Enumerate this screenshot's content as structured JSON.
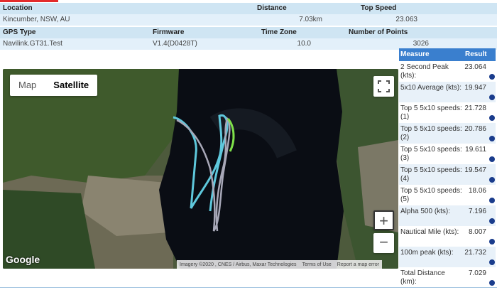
{
  "info": {
    "headers1": {
      "location": "Location",
      "distance": "Distance",
      "top_speed": "Top Speed"
    },
    "values1": {
      "location": "Kincumber, NSW, AU",
      "distance": "7.03km",
      "top_speed": "23.063"
    },
    "headers2": {
      "gps_type": "GPS Type",
      "firmware": "Firmware",
      "time_zone": "Time Zone",
      "num_points": "Number of Points"
    },
    "values2": {
      "gps_type": "Navilink.GT31.Test",
      "firmware": "V1.4(D0428T)",
      "time_zone": "10.0",
      "num_points": "3026"
    }
  },
  "map": {
    "type_map": "Map",
    "type_satellite": "Satellite",
    "zoom_in": "+",
    "zoom_out": "−",
    "google_logo": "Google",
    "attribution": "Imagery ©2020 , CNES / Airbus, Maxar Technologies",
    "terms": "Terms of Use",
    "report": "Report a map error",
    "track_colors": [
      "#5ec8dc",
      "#a8a8b8",
      "#7ee04a"
    ]
  },
  "results": {
    "header_measure": "Measure",
    "header_result": "Result",
    "rows": [
      {
        "label": "2 Second Peak (kts):",
        "value": "23.064"
      },
      {
        "label": "5x10 Average (kts):",
        "value": "19.947"
      },
      {
        "label": "Top 5 5x10 speeds: (1)",
        "value": "21.728"
      },
      {
        "label": "Top 5 5x10 speeds: (2)",
        "value": "20.786"
      },
      {
        "label": "Top 5 5x10 speeds: (3)",
        "value": "19.611"
      },
      {
        "label": "Top 5 5x10 speeds: (4)",
        "value": "19.547"
      },
      {
        "label": "Top 5 5x10 speeds: (5)",
        "value": "18.06"
      },
      {
        "label": "Alpha 500 (kts):",
        "value": "7.196"
      },
      {
        "label": "Nautical Mile (kts):",
        "value": "8.007"
      },
      {
        "label": "100m peak (kts):",
        "value": "21.732"
      },
      {
        "label": "Total Distance (km):",
        "value": "7.029"
      }
    ]
  }
}
